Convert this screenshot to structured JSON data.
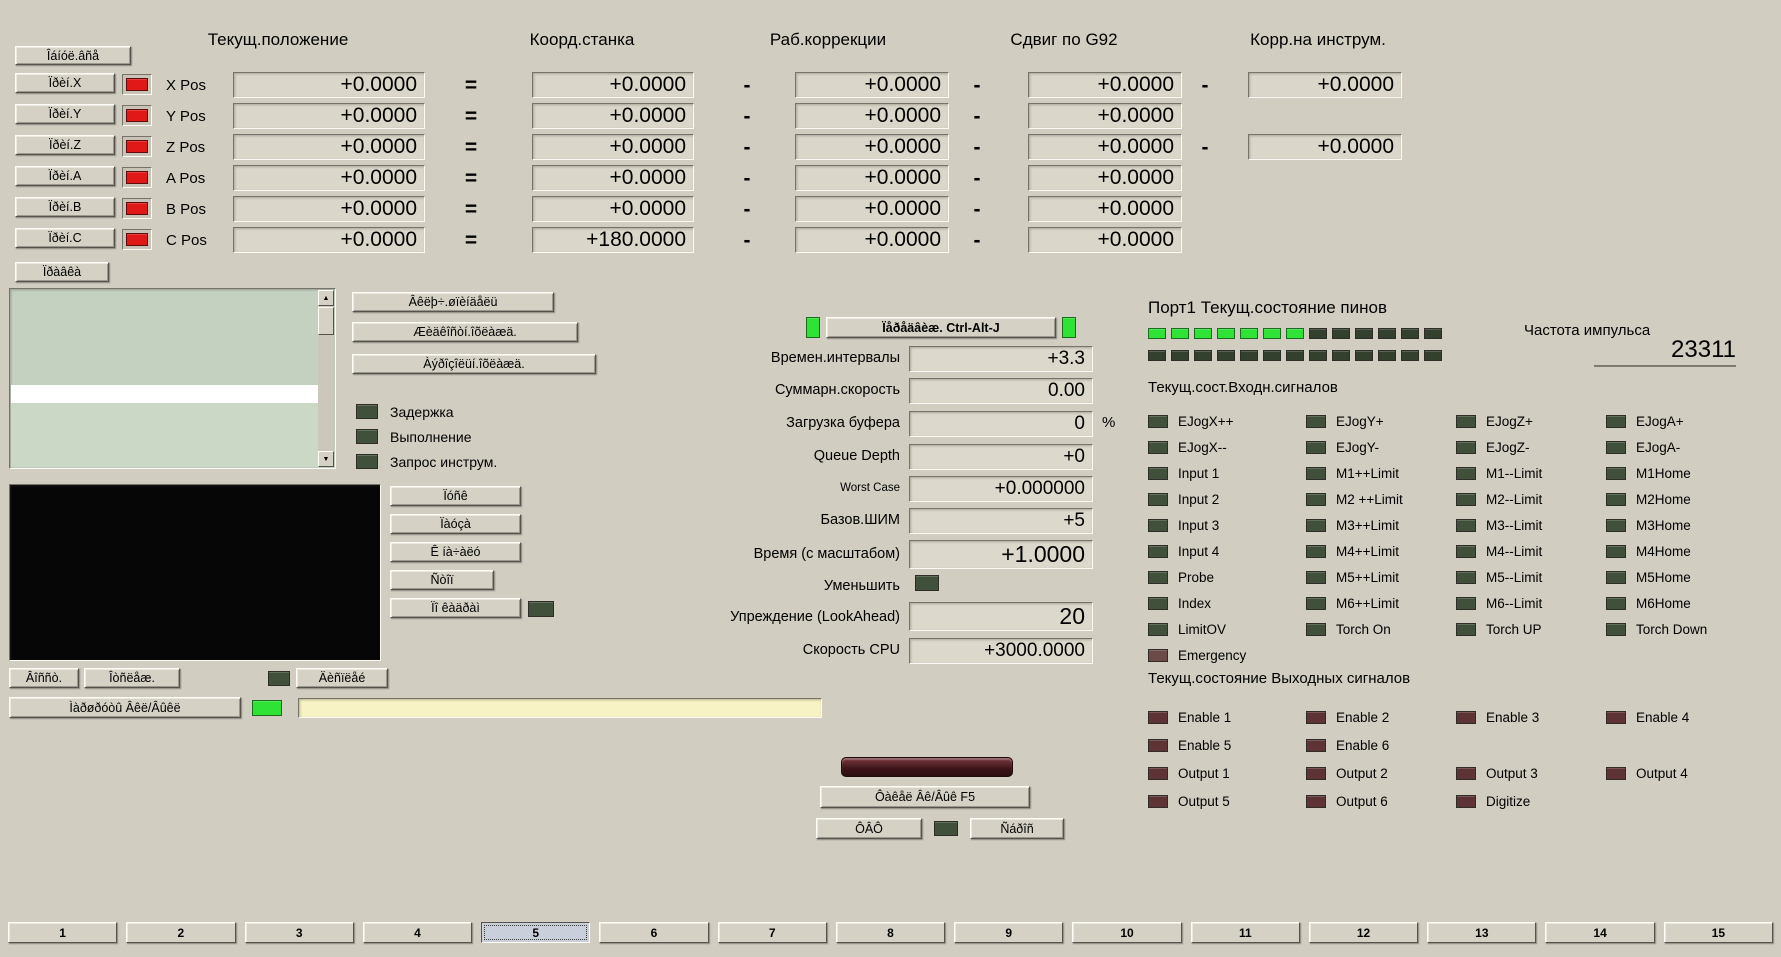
{
  "colors": {
    "axis_led": "#e01818",
    "green_on": "#2fe236",
    "green_off": "#33402e",
    "input_off": "#41503a",
    "output_off": "#5d3335",
    "status_yellow": "#f7f3c5"
  },
  "dro": {
    "zero_all": "Îáíóë.âñå",
    "edit": "Ïðàâêà",
    "headers": [
      "Текущ.положение",
      "Коорд.станка",
      "Раб.коррекции",
      "Сдвиг по G92",
      "Корр.на инструм."
    ],
    "rows": [
      {
        "btn": "Ïðèí.X",
        "axis": "X Pos",
        "cur": "+0.0000",
        "eq": "=",
        "machine": "+0.0000",
        "d1": "-",
        "work": "+0.0000",
        "d2": "-",
        "g92": "+0.0000",
        "d3": "-",
        "tool": "+0.0000",
        "tool_hide": ""
      },
      {
        "btn": "Ïðèí.Y",
        "axis": "Y Pos",
        "cur": "+0.0000",
        "eq": "=",
        "machine": "+0.0000",
        "d1": "-",
        "work": "+0.0000",
        "d2": "-",
        "g92": "+0.0000",
        "d3": "",
        "tool": "",
        "tool_hide": "hide"
      },
      {
        "btn": "Ïðèí.Z",
        "axis": "Z Pos",
        "cur": "+0.0000",
        "eq": "=",
        "machine": "+0.0000",
        "d1": "-",
        "work": "+0.0000",
        "d2": "-",
        "g92": "+0.0000",
        "d3": "-",
        "tool": "+0.0000",
        "tool_hide": ""
      },
      {
        "btn": "Ïðèí.A",
        "axis": "A Pos",
        "cur": "+0.0000",
        "eq": "=",
        "machine": "+0.0000",
        "d1": "-",
        "work": "+0.0000",
        "d2": "-",
        "g92": "+0.0000",
        "d3": "",
        "tool": "",
        "tool_hide": "hide"
      },
      {
        "btn": "Ïðèí.B",
        "axis": "B Pos",
        "cur": "+0.0000",
        "eq": "=",
        "machine": "+0.0000",
        "d1": "-",
        "work": "+0.0000",
        "d2": "-",
        "g92": "+0.0000",
        "d3": "",
        "tool": "",
        "tool_hide": "hide"
      },
      {
        "btn": "Ïðèí.C",
        "axis": "C Pos",
        "cur": "+0.0000",
        "eq": "=",
        "machine": "+180.0000",
        "d1": "-",
        "work": "+0.0000",
        "d2": "-",
        "g92": "+0.0000",
        "d3": "",
        "tool": "",
        "tool_hide": "hide"
      }
    ]
  },
  "history": {
    "buttons": [
      "Âêëþ÷.øïèíäåëü",
      "Æèäêîñòí.îõëàæä.",
      "Àýðîçîëüí.îõëàæä."
    ],
    "flags": [
      {
        "label": "Задержка"
      },
      {
        "label": "Выполнение"
      },
      {
        "label": "Запрос инструм."
      }
    ]
  },
  "transport": {
    "start": "Ïóñê",
    "pause": "Ïàóçà",
    "to_start": "Ê íà÷àëó",
    "stop": "Ñòîï",
    "single": "Ïî êàäðàì"
  },
  "bottombar": {
    "restore": "Âîññò.",
    "trace": "Îòñëåæ.",
    "display": "Äèñïëåé",
    "toggle": "Ìàðøðóòû Âêë/Âûêë",
    "status_value": ""
  },
  "jog": {
    "button": "Ïåðåäâèæ. Ctrl-Alt-J"
  },
  "stats": {
    "rows": [
      {
        "label": "Времен.интервалы",
        "value": "+3.3",
        "suffix": ""
      },
      {
        "label": "Суммарн.скорость",
        "value": "0.00",
        "suffix": ""
      },
      {
        "label": "Загрузка буфера",
        "value": "0",
        "suffix": "%"
      },
      {
        "label": "Queue Depth",
        "value": "+0",
        "suffix": ""
      },
      {
        "label": "Worst Case",
        "value": "+0.000000",
        "suffix": ""
      },
      {
        "label": "Базов.ШИМ",
        "value": "+5",
        "suffix": ""
      },
      {
        "label": "Время (с масштабом)",
        "value": "+1.0000",
        "suffix": ""
      },
      {
        "label": "Уменьшить",
        "value": "",
        "suffix": ""
      },
      {
        "label": "Упреждение (LookAhead)",
        "value": "20",
        "suffix": ""
      },
      {
        "label": "Скорость CPU",
        "value": "+3000.0000",
        "suffix": ""
      }
    ]
  },
  "port1": {
    "title": "Порт1 Текущ.состояние пинов",
    "row1": [
      "on",
      "on",
      "on",
      "on",
      "on",
      "on",
      "on",
      "off",
      "off",
      "off",
      "off",
      "off",
      "off"
    ],
    "row2": [
      "off",
      "off",
      "off",
      "off",
      "off",
      "off",
      "off",
      "off",
      "off",
      "off",
      "off",
      "off",
      "off"
    ]
  },
  "pulse": {
    "label": "Частота импульса",
    "value": "23311"
  },
  "inputs": {
    "title": "Текущ.сост.Входн.сигналов",
    "cols": [
      [
        {
          "label": "EJogX++",
          "led": "dgreen"
        },
        {
          "label": "EJogX--",
          "led": "dgreen"
        },
        {
          "label": "Input 1",
          "led": "dgreen"
        },
        {
          "label": "Input 2",
          "led": "dgreen"
        },
        {
          "label": "Input 3",
          "led": "dgreen"
        },
        {
          "label": "Input 4",
          "led": "dgreen"
        },
        {
          "label": "Probe",
          "led": "dgreen"
        },
        {
          "label": "Index",
          "led": "dgreen"
        },
        {
          "label": "LimitOV",
          "led": "dgreen"
        },
        {
          "label": "Emergency",
          "led": "brown"
        }
      ],
      [
        {
          "label": "EJogY+",
          "led": "dgreen"
        },
        {
          "label": "EJogY-",
          "led": "dgreen"
        },
        {
          "label": "M1++Limit",
          "led": "dgreen"
        },
        {
          "label": "M2 ++Limit",
          "led": "dgreen"
        },
        {
          "label": "M3++Limit",
          "led": "dgreen"
        },
        {
          "label": "M4++Limit",
          "led": "dgreen"
        },
        {
          "label": "M5++Limit",
          "led": "dgreen"
        },
        {
          "label": "M6++Limit",
          "led": "dgreen"
        },
        {
          "label": "Torch On",
          "led": "dgreen"
        }
      ],
      [
        {
          "label": "EJogZ+",
          "led": "dgreen"
        },
        {
          "label": "EJogZ-",
          "led": "dgreen"
        },
        {
          "label": "M1--Limit",
          "led": "dgreen"
        },
        {
          "label": "M2--Limit",
          "led": "dgreen"
        },
        {
          "label": "M3--Limit",
          "led": "dgreen"
        },
        {
          "label": "M4--Limit",
          "led": "dgreen"
        },
        {
          "label": "M5--Limit",
          "led": "dgreen"
        },
        {
          "label": "M6--Limit",
          "led": "dgreen"
        },
        {
          "label": "Torch UP",
          "led": "dgreen"
        }
      ],
      [
        {
          "label": "EJogA+",
          "led": "dgreen"
        },
        {
          "label": "EJogA-",
          "led": "dgreen"
        },
        {
          "label": "M1Home",
          "led": "dgreen"
        },
        {
          "label": "M2Home",
          "led": "dgreen"
        },
        {
          "label": "M3Home",
          "led": "dgreen"
        },
        {
          "label": "M4Home",
          "led": "dgreen"
        },
        {
          "label": "M5Home",
          "led": "dgreen"
        },
        {
          "label": "M6Home",
          "led": "dgreen"
        },
        {
          "label": "Torch Down",
          "led": "dgreen"
        }
      ]
    ]
  },
  "outputs": {
    "title": "Текущ.состояние Выходных сигналов",
    "cols": [
      [
        {
          "label": "Enable 1",
          "led": "maroon"
        },
        {
          "label": "Enable 5",
          "led": "maroon"
        },
        {
          "label": "Output 1",
          "led": "maroon"
        },
        {
          "label": "Output 5",
          "led": "maroon"
        }
      ],
      [
        {
          "label": "Enable 2",
          "led": "maroon"
        },
        {
          "label": "Enable 6",
          "led": "maroon"
        },
        {
          "label": "Output 2",
          "led": "maroon"
        },
        {
          "label": "Output 6",
          "led": "maroon"
        }
      ],
      [
        {
          "label": "Enable 3",
          "led": "maroon"
        },
        {
          "label": "",
          "led": "none"
        },
        {
          "label": "Output 3",
          "led": "maroon"
        },
        {
          "label": "Digitize",
          "led": "maroon"
        }
      ],
      [
        {
          "label": "Enable 4",
          "led": "maroon"
        },
        {
          "label": "",
          "led": "none"
        },
        {
          "label": "Output 4",
          "led": "maroon"
        },
        {
          "label": "",
          "led": "none"
        }
      ]
    ]
  },
  "torch": {
    "toggle": "Ôàêåë Âê/Âûê F5",
    "thc": "ÔÂÔ",
    "reset": "Ñáðîñ"
  },
  "scroll": {
    "up": "▲",
    "down": "▼"
  },
  "tabs": {
    "items": [
      {
        "label": "1",
        "state": ""
      },
      {
        "label": "2",
        "state": ""
      },
      {
        "label": "3",
        "state": ""
      },
      {
        "label": "4",
        "state": ""
      },
      {
        "label": "5",
        "state": "active"
      },
      {
        "label": "6",
        "state": ""
      },
      {
        "label": "7",
        "state": ""
      },
      {
        "label": "8",
        "state": ""
      },
      {
        "label": "9",
        "state": ""
      },
      {
        "label": "10",
        "state": ""
      },
      {
        "label": "11",
        "state": ""
      },
      {
        "label": "12",
        "state": ""
      },
      {
        "label": "13",
        "state": ""
      },
      {
        "label": "14",
        "state": ""
      },
      {
        "label": "15",
        "state": ""
      }
    ]
  }
}
